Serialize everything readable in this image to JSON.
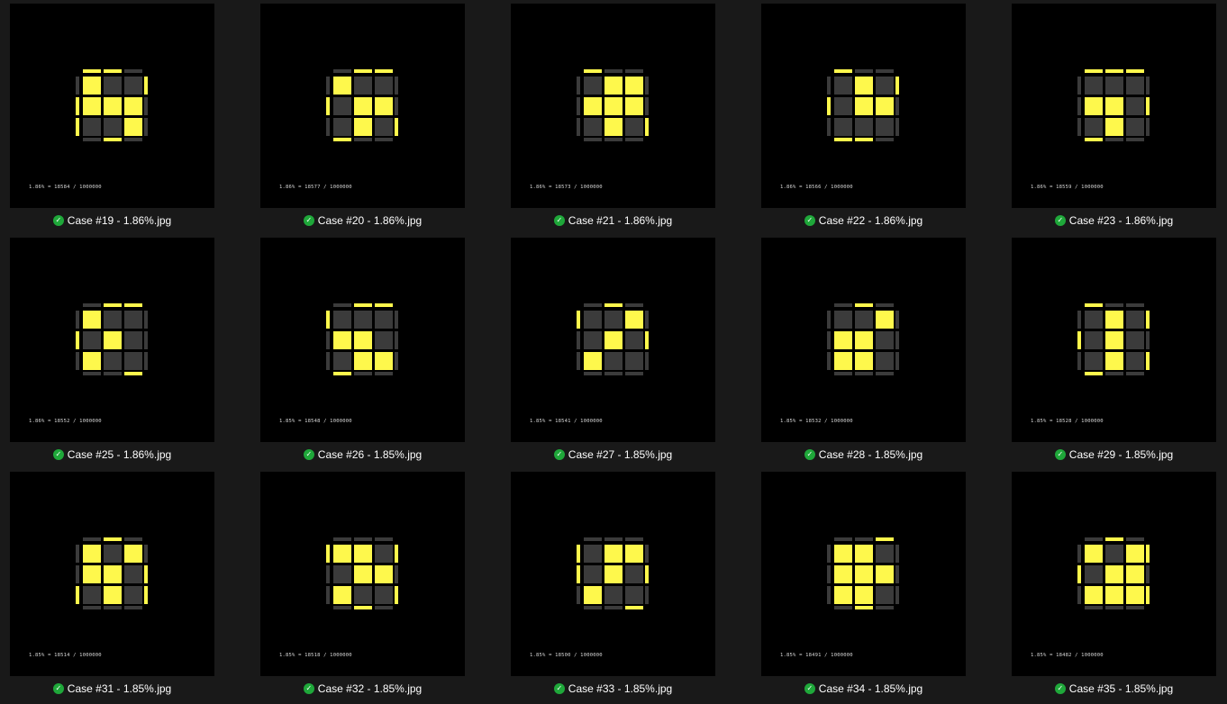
{
  "colors": {
    "background": "#191919",
    "thumb_background": "#000000",
    "sticker_yellow": "#fef84c",
    "sticker_gray": "#3b3b3b",
    "status_ok": "#1fa83a"
  },
  "status_icon": "checkmark-icon",
  "files": [
    {
      "caption": "Case #19 - 1.86%.jpg",
      "stat": "1.86% = 18584 / 1000000",
      "face": [
        1,
        0,
        0,
        1,
        1,
        1,
        0,
        0,
        1
      ],
      "top": [
        1,
        1,
        0
      ],
      "bottom": [
        0,
        1,
        0
      ],
      "left": [
        0,
        1,
        1
      ],
      "right": [
        1,
        0,
        0
      ]
    },
    {
      "caption": "Case #20 - 1.86%.jpg",
      "stat": "1.86% = 18577 / 1000000",
      "face": [
        1,
        0,
        0,
        0,
        1,
        1,
        0,
        1,
        0
      ],
      "top": [
        0,
        1,
        1
      ],
      "bottom": [
        1,
        0,
        0
      ],
      "left": [
        0,
        1,
        0
      ],
      "right": [
        0,
        0,
        1
      ]
    },
    {
      "caption": "Case #21 - 1.86%.jpg",
      "stat": "1.86% = 18573 / 1000000",
      "face": [
        0,
        1,
        1,
        1,
        1,
        1,
        0,
        1,
        0
      ],
      "top": [
        1,
        0,
        0
      ],
      "bottom": [
        0,
        0,
        0
      ],
      "left": [
        0,
        0,
        0
      ],
      "right": [
        0,
        0,
        1
      ]
    },
    {
      "caption": "Case #22 - 1.86%.jpg",
      "stat": "1.86% = 18566 / 1000000",
      "face": [
        0,
        1,
        0,
        0,
        1,
        1,
        0,
        0,
        0
      ],
      "top": [
        1,
        0,
        0
      ],
      "bottom": [
        1,
        1,
        0
      ],
      "left": [
        0,
        1,
        0
      ],
      "right": [
        1,
        0,
        0
      ]
    },
    {
      "caption": "Case #23 - 1.86%.jpg",
      "stat": "1.86% = 18559 / 1000000",
      "face": [
        0,
        0,
        0,
        1,
        1,
        0,
        0,
        1,
        0
      ],
      "top": [
        1,
        1,
        1
      ],
      "bottom": [
        1,
        0,
        0
      ],
      "left": [
        0,
        0,
        0
      ],
      "right": [
        0,
        1,
        0
      ]
    },
    {
      "caption": "Case #25 - 1.86%.jpg",
      "stat": "1.86% = 18552 / 1000000",
      "face": [
        1,
        0,
        0,
        0,
        1,
        0,
        1,
        0,
        0
      ],
      "top": [
        0,
        1,
        1
      ],
      "bottom": [
        0,
        0,
        1
      ],
      "left": [
        0,
        1,
        0
      ],
      "right": [
        0,
        0,
        0
      ]
    },
    {
      "caption": "Case #26 - 1.85%.jpg",
      "stat": "1.85% = 18548 / 1000000",
      "face": [
        0,
        0,
        0,
        1,
        1,
        0,
        0,
        1,
        1
      ],
      "top": [
        0,
        1,
        1
      ],
      "bottom": [
        1,
        0,
        0
      ],
      "left": [
        1,
        0,
        0
      ],
      "right": [
        0,
        0,
        0
      ]
    },
    {
      "caption": "Case #27 - 1.85%.jpg",
      "stat": "1.85% = 18541 / 1000000",
      "face": [
        0,
        0,
        1,
        0,
        1,
        0,
        1,
        0,
        0
      ],
      "top": [
        0,
        1,
        0
      ],
      "bottom": [
        0,
        0,
        0
      ],
      "left": [
        1,
        0,
        0
      ],
      "right": [
        0,
        1,
        0
      ]
    },
    {
      "caption": "Case #28 - 1.85%.jpg",
      "stat": "1.85% = 18532 / 1000000",
      "face": [
        0,
        0,
        1,
        1,
        1,
        0,
        1,
        1,
        0
      ],
      "top": [
        0,
        1,
        0
      ],
      "bottom": [
        0,
        0,
        0
      ],
      "left": [
        0,
        0,
        0
      ],
      "right": [
        0,
        0,
        0
      ]
    },
    {
      "caption": "Case #29 - 1.85%.jpg",
      "stat": "1.85% = 18528 / 1000000",
      "face": [
        0,
        1,
        0,
        0,
        1,
        0,
        0,
        1,
        0
      ],
      "top": [
        1,
        0,
        0
      ],
      "bottom": [
        1,
        0,
        0
      ],
      "left": [
        0,
        1,
        0
      ],
      "right": [
        1,
        0,
        1
      ]
    },
    {
      "caption": "Case #31 - 1.85%.jpg",
      "stat": "1.85% = 18514 / 1000000",
      "face": [
        1,
        0,
        1,
        1,
        1,
        0,
        0,
        1,
        0
      ],
      "top": [
        0,
        1,
        0
      ],
      "bottom": [
        0,
        0,
        0
      ],
      "left": [
        0,
        0,
        1
      ],
      "right": [
        0,
        1,
        1
      ]
    },
    {
      "caption": "Case #32 - 1.85%.jpg",
      "stat": "1.85% = 18518 / 1000000",
      "face": [
        1,
        1,
        0,
        0,
        1,
        1,
        1,
        0,
        0
      ],
      "top": [
        0,
        0,
        0
      ],
      "bottom": [
        0,
        1,
        0
      ],
      "left": [
        1,
        0,
        0
      ],
      "right": [
        1,
        0,
        1
      ]
    },
    {
      "caption": "Case #33 - 1.85%.jpg",
      "stat": "1.85% = 18500 / 1000000",
      "face": [
        0,
        1,
        1,
        0,
        1,
        0,
        1,
        0,
        0
      ],
      "top": [
        0,
        0,
        0
      ],
      "bottom": [
        0,
        0,
        1
      ],
      "left": [
        1,
        1,
        0
      ],
      "right": [
        0,
        1,
        0
      ]
    },
    {
      "caption": "Case #34 - 1.85%.jpg",
      "stat": "1.85% = 18491 / 1000000",
      "face": [
        1,
        1,
        0,
        1,
        1,
        1,
        1,
        1,
        0
      ],
      "top": [
        0,
        0,
        1
      ],
      "bottom": [
        0,
        1,
        0
      ],
      "left": [
        0,
        0,
        0
      ],
      "right": [
        0,
        0,
        0
      ]
    },
    {
      "caption": "Case #35 - 1.85%.jpg",
      "stat": "1.85% = 18482 / 1000000",
      "face": [
        1,
        0,
        1,
        0,
        1,
        1,
        1,
        1,
        1
      ],
      "top": [
        0,
        1,
        0
      ],
      "bottom": [
        0,
        0,
        0
      ],
      "left": [
        0,
        1,
        0
      ],
      "right": [
        1,
        0,
        1
      ]
    }
  ]
}
